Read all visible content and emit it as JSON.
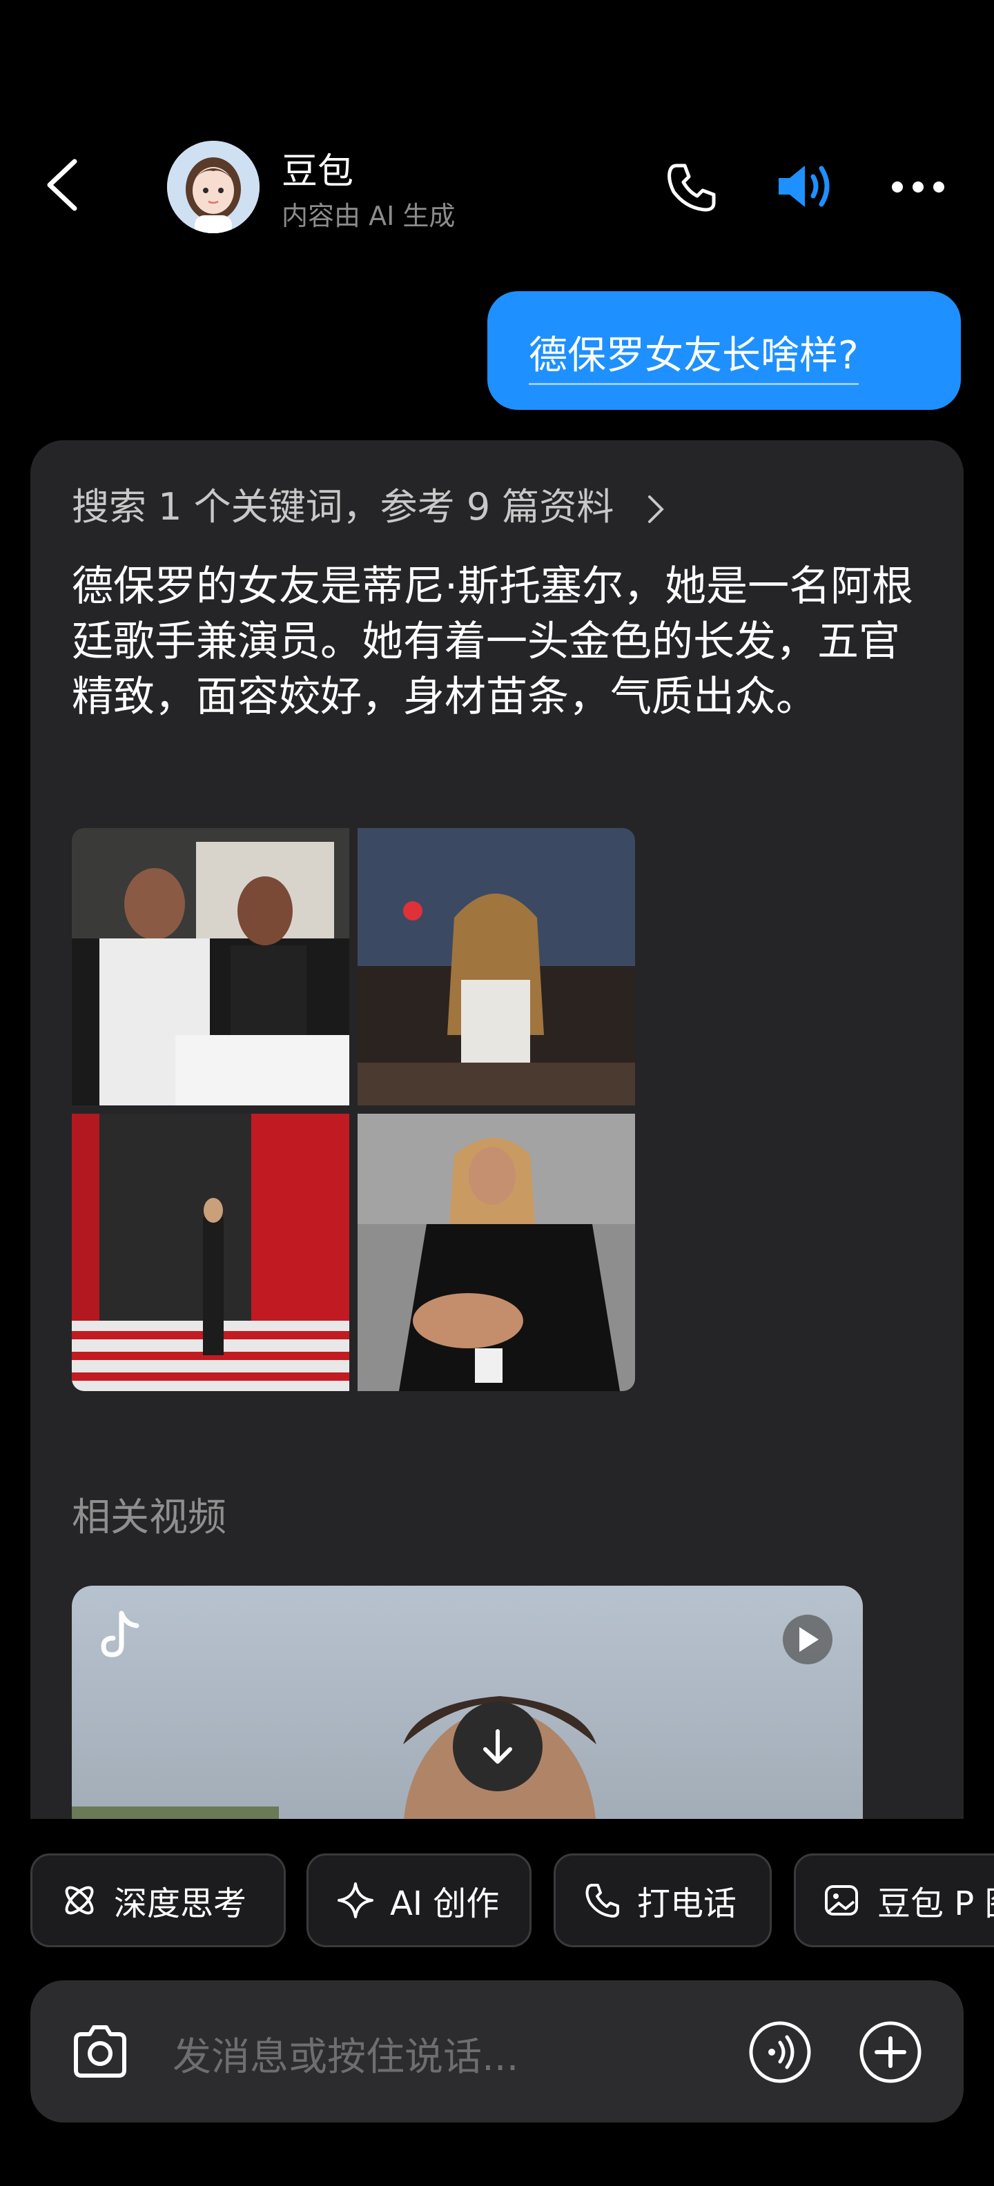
{
  "header": {
    "title": "豆包",
    "subtitle": "内容由 AI 生成",
    "icons": [
      "back-icon",
      "avatar",
      "phone-icon",
      "speaker-icon",
      "more-icon"
    ],
    "accent": "#1e90ff"
  },
  "chat": {
    "user_message": "德保罗女友长啥样?",
    "search_summary": "搜索 1 个关键词，参考 9 篇资料",
    "answer_text": "德保罗的女友是蒂尼·斯托塞尔，她是一名阿根廷歌手兼演员。她有着一头金色的长发，五官精致，面容姣好，身材苗条，气质出众。",
    "image_count": 4,
    "related_title": "相关视频"
  },
  "chips": [
    {
      "label": "深度思考",
      "icon": "deep-think-icon"
    },
    {
      "label": "AI 创作",
      "icon": "sparkle-icon"
    },
    {
      "label": "打电话",
      "icon": "phone-icon"
    },
    {
      "label": "豆包 P 图",
      "icon": "image-edit-icon"
    }
  ],
  "input": {
    "placeholder": "发消息或按住说话..."
  }
}
